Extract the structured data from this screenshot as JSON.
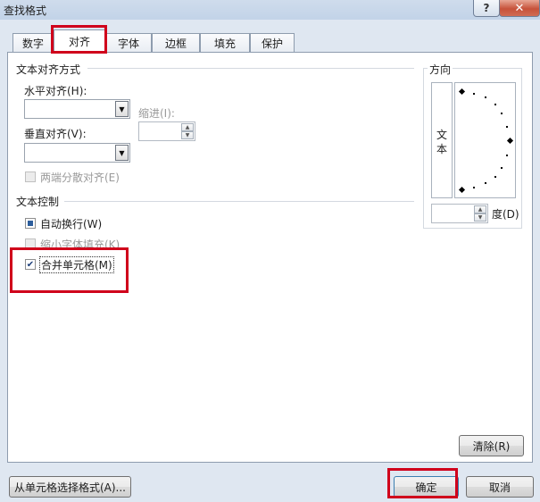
{
  "window": {
    "title": "查找格式",
    "help_label": "?",
    "close_label": "✕"
  },
  "tabs": [
    {
      "label": "数字"
    },
    {
      "label": "对齐"
    },
    {
      "label": "字体"
    },
    {
      "label": "边框"
    },
    {
      "label": "填充"
    },
    {
      "label": "保护"
    }
  ],
  "alignment": {
    "section_title": "文本对齐方式",
    "horizontal_label": "水平对齐(H):",
    "horizontal_value": "",
    "indent_label": "缩进(I):",
    "indent_value": "",
    "vertical_label": "垂直对齐(V):",
    "vertical_value": "",
    "justify_distributed_label": "两端分散对齐(E)"
  },
  "text_control": {
    "section_title": "文本控制",
    "wrap_text_label": "自动换行(W)",
    "shrink_to_fit_label": "缩小字体填充(K)",
    "merge_cells_label": "合并单元格(M)",
    "merge_cells_checked": true
  },
  "orientation": {
    "section_title": "方向",
    "vertical_text": "文本",
    "degrees_value": "",
    "degrees_label": "度(D)"
  },
  "buttons": {
    "clear_label": "清除(R)",
    "from_cell_label": "从单元格选择格式(A)...",
    "ok_label": "确定",
    "cancel_label": "取消"
  },
  "colors": {
    "highlight": "#d0001b",
    "dialog_bg": "#dfe7f1"
  }
}
